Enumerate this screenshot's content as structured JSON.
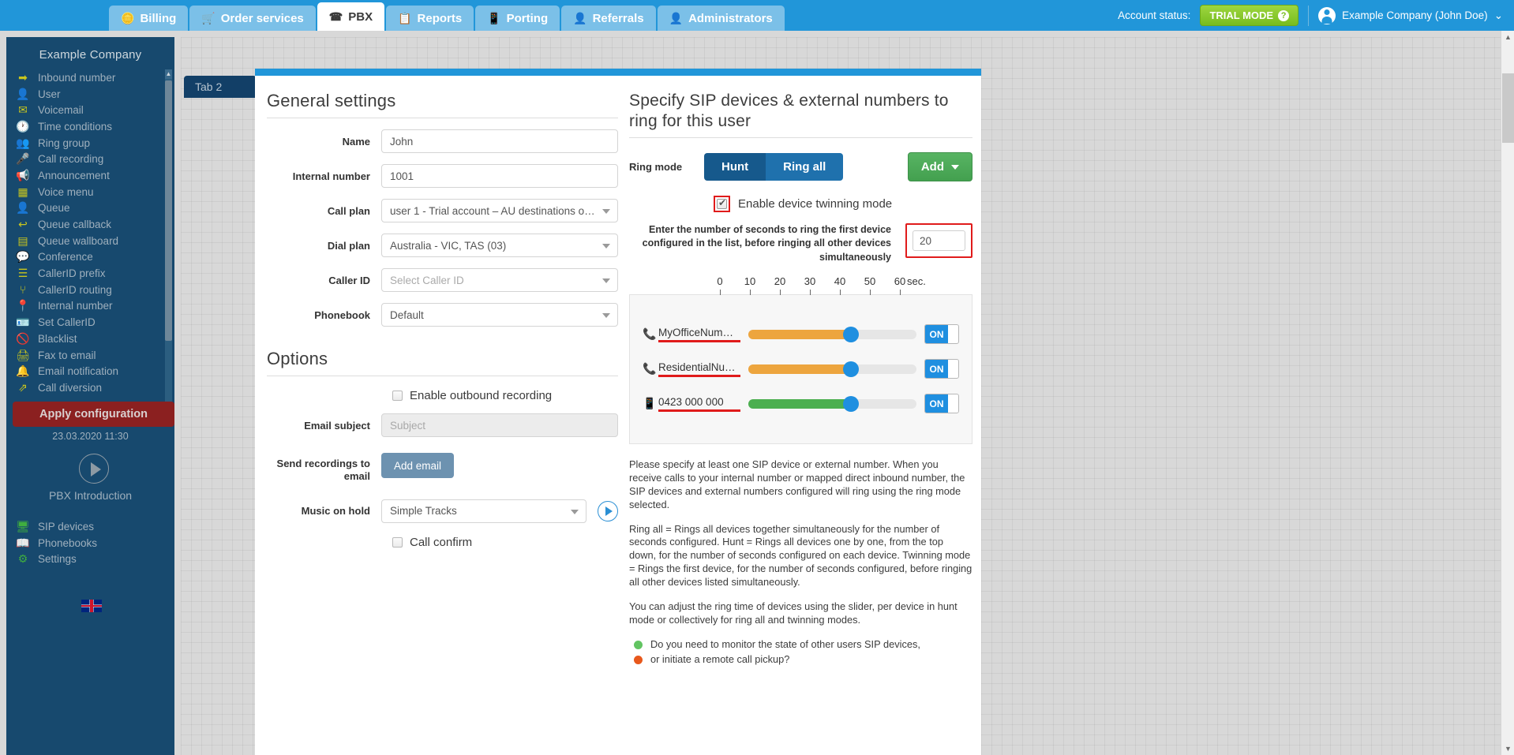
{
  "topbar": {
    "tabs": [
      {
        "label": "Billing",
        "icon": "coins-icon",
        "active": false
      },
      {
        "label": "Order services",
        "icon": "cart-icon",
        "active": false
      },
      {
        "label": "PBX",
        "icon": "pbx-icon",
        "active": true
      },
      {
        "label": "Reports",
        "icon": "report-icon",
        "active": false
      },
      {
        "label": "Porting",
        "icon": "mobile-icon",
        "active": false
      },
      {
        "label": "Referrals",
        "icon": "person-icon",
        "active": false
      },
      {
        "label": "Administrators",
        "icon": "admin-icon",
        "active": false
      }
    ],
    "account_status_label": "Account status:",
    "trial_badge": "TRIAL MODE",
    "trial_help": "?",
    "user_name": "Example Company (John Doe)",
    "user_caret": "⌄"
  },
  "sidebar": {
    "company": "Example Company",
    "items": [
      {
        "label": "Inbound number",
        "icon": "arrow-right-icon"
      },
      {
        "label": "User",
        "icon": "user-icon"
      },
      {
        "label": "Voicemail",
        "icon": "envelope-icon"
      },
      {
        "label": "Time conditions",
        "icon": "clock-icon"
      },
      {
        "label": "Ring group",
        "icon": "users-icon"
      },
      {
        "label": "Call recording",
        "icon": "microphone-icon"
      },
      {
        "label": "Announcement",
        "icon": "megaphone-icon"
      },
      {
        "label": "Voice menu",
        "icon": "grid-icon"
      },
      {
        "label": "Queue",
        "icon": "user-plus-icon"
      },
      {
        "label": "Queue callback",
        "icon": "reply-arrow-icon"
      },
      {
        "label": "Queue wallboard",
        "icon": "table-icon"
      },
      {
        "label": "Conference",
        "icon": "chat-bubbles-icon"
      },
      {
        "label": "CallerID prefix",
        "icon": "list-icon"
      },
      {
        "label": "CallerID routing",
        "icon": "sitemap-icon"
      },
      {
        "label": "Internal number",
        "icon": "pin-icon"
      },
      {
        "label": "Set CallerID",
        "icon": "id-card-icon"
      },
      {
        "label": "Blacklist",
        "icon": "ban-icon"
      },
      {
        "label": "Fax to email",
        "icon": "printer-icon"
      },
      {
        "label": "Email notification",
        "icon": "bell-icon"
      },
      {
        "label": "Call diversion",
        "icon": "diversion-icon"
      }
    ],
    "apply_button": "Apply configuration",
    "apply_date": "23.03.2020 11:30",
    "intro_label": "PBX Introduction",
    "bottom_items": [
      {
        "label": "SIP devices",
        "icon": "monitor-icon"
      },
      {
        "label": "Phonebooks",
        "icon": "book-icon"
      },
      {
        "label": "Settings",
        "icon": "gear-icon"
      }
    ],
    "language_flag": "uk-flag-icon"
  },
  "workspace": {
    "tab2_label": "Tab 2"
  },
  "general_settings": {
    "title": "General settings",
    "fields": [
      {
        "label": "Name",
        "value": "John",
        "type": "text"
      },
      {
        "label": "Internal number",
        "value": "1001",
        "type": "text"
      },
      {
        "label": "Call plan",
        "value": "user 1 - Trial account – AU destinations o…",
        "type": "select"
      },
      {
        "label": "Dial plan",
        "value": "Australia - VIC, TAS (03)",
        "type": "select"
      },
      {
        "label": "Caller ID",
        "value": "Select Caller ID",
        "type": "select",
        "placeholder": true
      },
      {
        "label": "Phonebook",
        "value": "Default",
        "type": "select"
      }
    ]
  },
  "options": {
    "title": "Options",
    "outbound_recording_label": "Enable outbound recording",
    "email_subject_label": "Email subject",
    "email_subject_placeholder": "Subject",
    "send_recordings_label": "Send recordings to email",
    "add_email_button": "Add email",
    "music_on_hold_label": "Music on hold",
    "music_on_hold_value": "Simple Tracks",
    "play_icon": "play-icon",
    "call_confirm_label": "Call confirm"
  },
  "sip_panel": {
    "title": "Specify SIP devices & external numbers to ring for this user",
    "ring_mode_label": "Ring mode",
    "ring_modes": [
      {
        "label": "Hunt",
        "selected": true
      },
      {
        "label": "Ring all",
        "selected": false
      }
    ],
    "add_button": "Add",
    "twinning_label": "Enable device twinning mode",
    "twinning_checked": true,
    "seconds_help": "Enter the number of seconds to ring the first device configured in the list, before ringing all other devices simultaneously",
    "seconds_value": "20",
    "ruler": {
      "ticks": [
        0,
        10,
        20,
        30,
        40,
        50,
        60
      ],
      "unit": "sec."
    },
    "devices": [
      {
        "name": "MyOfficeNum…",
        "icon": "phone-handset-icon",
        "value": 32,
        "color": "#eda53e",
        "toggle": "ON"
      },
      {
        "name": "ResidentialNu…",
        "icon": "phone-handset-icon",
        "value": 32,
        "color": "#eda53e",
        "toggle": "ON"
      },
      {
        "name": "0423 000 000",
        "icon": "mobile-phone-icon",
        "value": 32,
        "color": "#4caf50",
        "toggle": "ON"
      }
    ],
    "help_paragraphs": [
      "Please specify at least one SIP device or external number.\nWhen you receive calls to your internal number or mapped direct inbound number, the SIP devices and external numbers configured will ring using the ring mode selected.",
      "Ring all = Rings all devices together simultaneously for the number of seconds configured.\nHunt = Rings all devices one by one, from the top down, for the number of seconds configured on each device.\nTwinning mode = Rings the first device, for the number of seconds configured, before ringing all other devices listed simultaneously.",
      "You can adjust the ring time of devices using the slider, per device in hunt mode or collectively for ring all and twinning modes."
    ],
    "bullets": [
      {
        "color": "#62c462",
        "text": "Do you need to monitor the state of other users SIP devices,"
      },
      {
        "color": "#e8581c",
        "text": "or initiate a remote call pickup?"
      }
    ]
  }
}
